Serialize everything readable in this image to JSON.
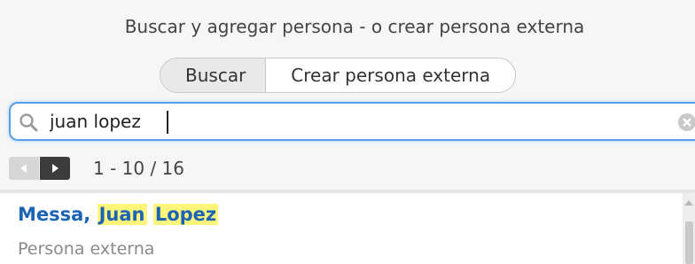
{
  "header": {
    "title": "Buscar y agregar persona - o crear persona externa"
  },
  "tabs": [
    {
      "label": "Buscar",
      "active": true
    },
    {
      "label": "Crear persona externa",
      "active": false
    }
  ],
  "search": {
    "value": "juan lopez",
    "icon": "search-icon",
    "clear_icon": "clear-icon",
    "focus_color": "#5aa0e8"
  },
  "pager": {
    "range": "1 - 10 / 16"
  },
  "results": [
    {
      "name_prefix": "Messa, ",
      "name_hl1": "Juan",
      "name_sep": " ",
      "name_hl2": "Lopez",
      "type": "Persona externa"
    }
  ],
  "colors": {
    "link": "#1a63b5",
    "highlight": "#fff57a"
  }
}
